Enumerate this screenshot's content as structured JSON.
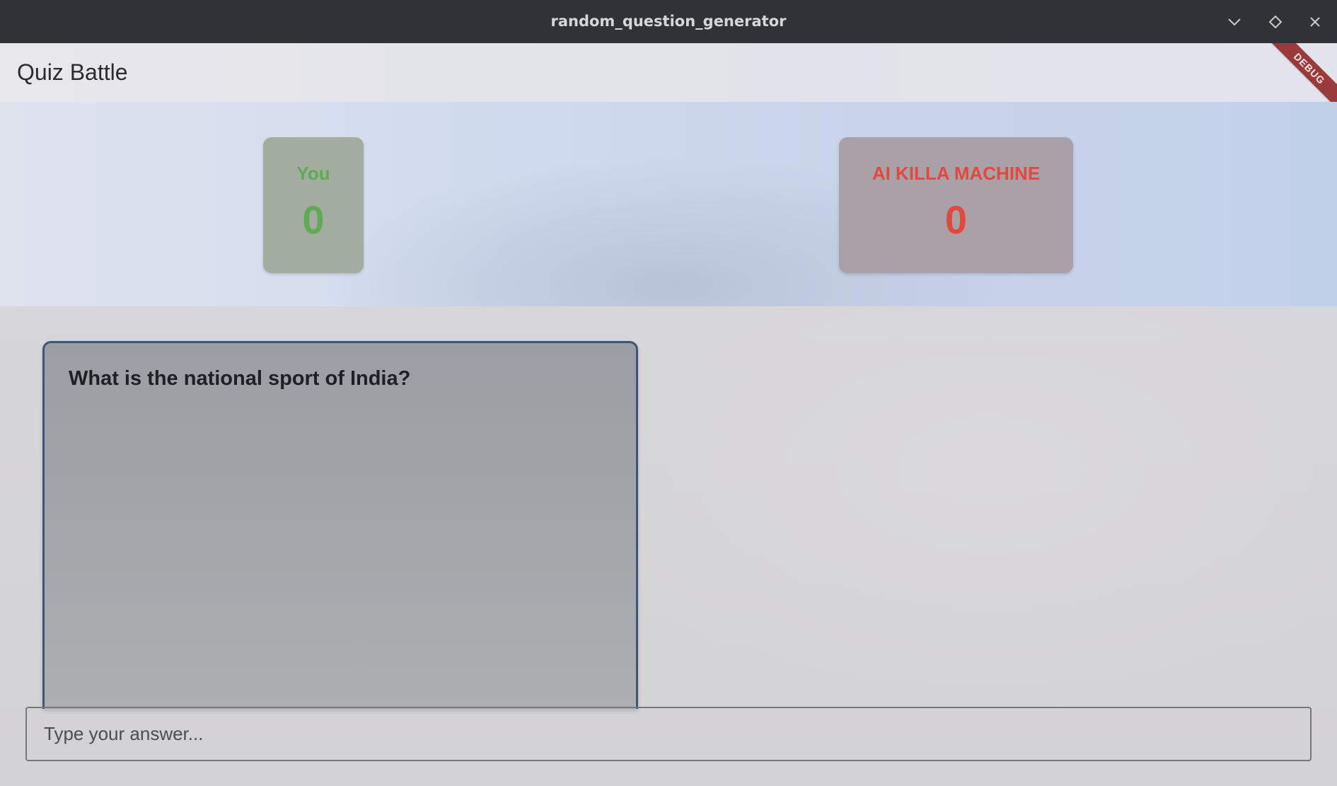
{
  "window": {
    "title": "random_question_generator",
    "controls": [
      "minimize-icon",
      "maximize-icon",
      "close-icon"
    ]
  },
  "appbar": {
    "title": "Quiz Battle",
    "debug_banner": "DEBUG"
  },
  "scoreboard": {
    "player": {
      "name": "You",
      "score": "0",
      "color": "#5fab55"
    },
    "opponent": {
      "name": "AI KILLA MACHINE",
      "score": "0",
      "color": "#e2483d"
    }
  },
  "question": {
    "text": "What is the national sport of India?"
  },
  "answer": {
    "value": "",
    "placeholder": "Type your answer..."
  }
}
